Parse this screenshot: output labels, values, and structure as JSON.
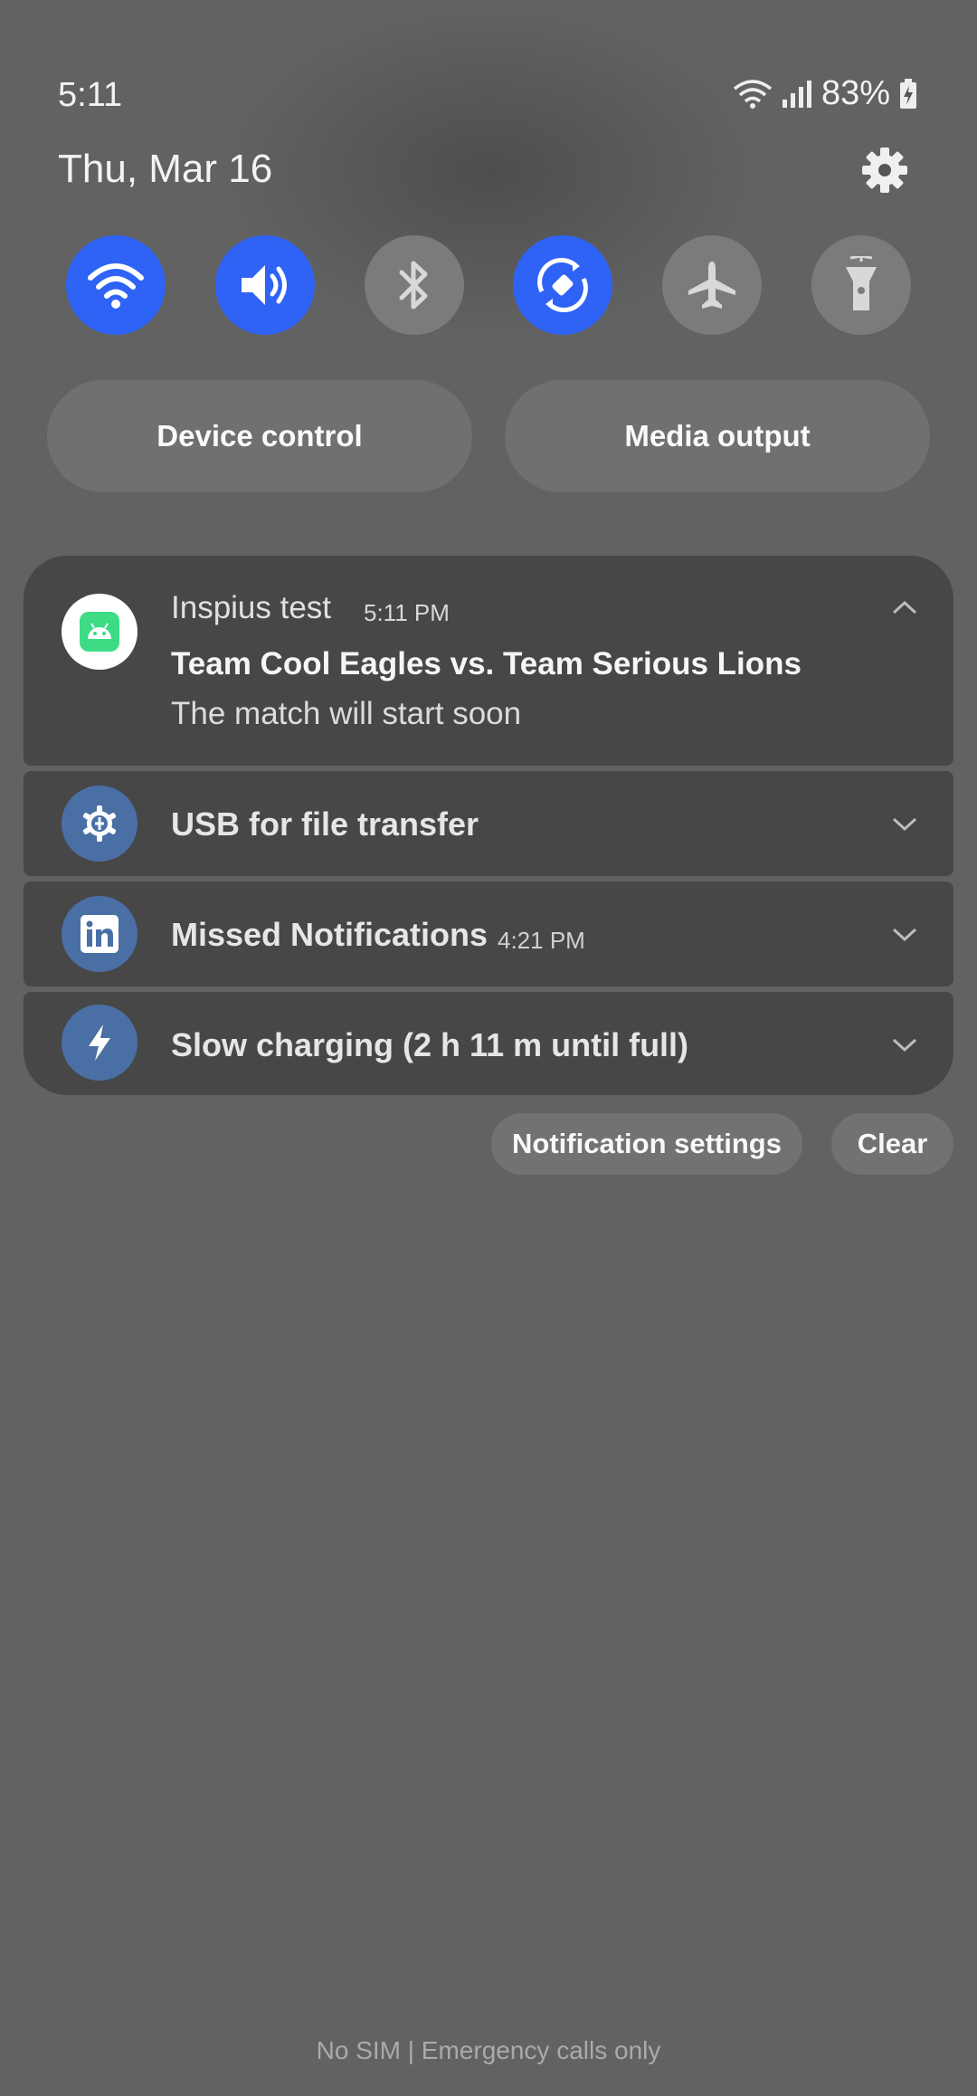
{
  "status_bar": {
    "time": "5:11",
    "battery": "83%"
  },
  "header": {
    "date": "Thu, Mar 16"
  },
  "quick_toggles": [
    {
      "name": "wifi-icon",
      "state": "on"
    },
    {
      "name": "sound-icon",
      "state": "on"
    },
    {
      "name": "bluetooth-icon",
      "state": "off"
    },
    {
      "name": "auto-rotate-icon",
      "state": "on"
    },
    {
      "name": "airplane-icon",
      "state": "off"
    },
    {
      "name": "flashlight-icon",
      "state": "off"
    }
  ],
  "panels": {
    "device_control": "Device control",
    "media_output": "Media output"
  },
  "notifications": [
    {
      "app": "Inspius test",
      "time": "5:11 PM",
      "title": "Team Cool Eagles vs. Team Serious Lions",
      "body": "The match will start soon"
    },
    {
      "title": "USB for file transfer"
    },
    {
      "title": "Missed Notifications",
      "time": "4:21 PM"
    },
    {
      "title": "Slow charging (2 h 11 m until full)"
    }
  ],
  "actions": {
    "notification_settings": "Notification settings",
    "clear": "Clear"
  },
  "footer": "No SIM | Emergency calls only",
  "colors": {
    "accent": "#2f63f6",
    "card": "#474747",
    "icon_blue": "#4a6fa5"
  }
}
